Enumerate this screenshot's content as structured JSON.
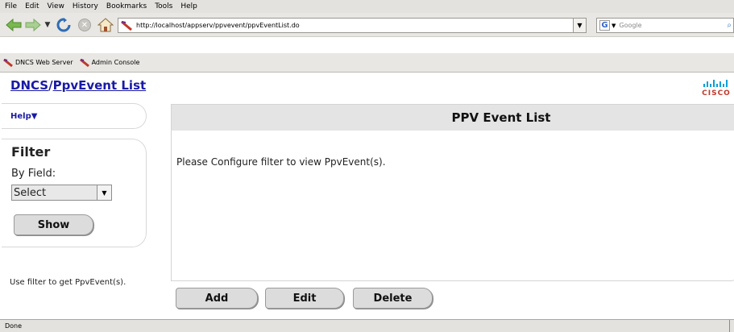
{
  "browser": {
    "menu": [
      {
        "label": "File"
      },
      {
        "label": "Edit"
      },
      {
        "label": "View"
      },
      {
        "label": "History"
      },
      {
        "label": "Bookmarks"
      },
      {
        "label": "Tools"
      },
      {
        "label": "Help"
      }
    ],
    "url": "http://localhost/appserv/ppvevent/ppvEventList.do",
    "search_placeholder": "Google",
    "search_engine_icon": "G",
    "bookmarks": [
      {
        "label": "DNCS Web Server"
      },
      {
        "label": "Admin Console"
      }
    ],
    "status": "Done"
  },
  "page": {
    "breadcrumb_root": "DNCS",
    "breadcrumb_separator": "/",
    "breadcrumb_current": "PpvEvent List",
    "logo_text": "CISCO",
    "help_label": "Help▼",
    "filter_title": "Filter",
    "filter_by_field_label": "By Field:",
    "filter_select_value": "Select",
    "show_button": "Show",
    "filter_hint": "Use filter to get PpvEvent(s).",
    "panel_title": "PPV Event List",
    "panel_message": "Please Configure filter to view PpvEvent(s).",
    "buttons": {
      "add": "Add",
      "edit": "Edit",
      "delete": "Delete"
    }
  },
  "colors": {
    "link": "#1a1aa6",
    "panel_header": "#e4e4e4",
    "cisco_bars": "#049fd9",
    "cisco_text": "#c0392b"
  }
}
